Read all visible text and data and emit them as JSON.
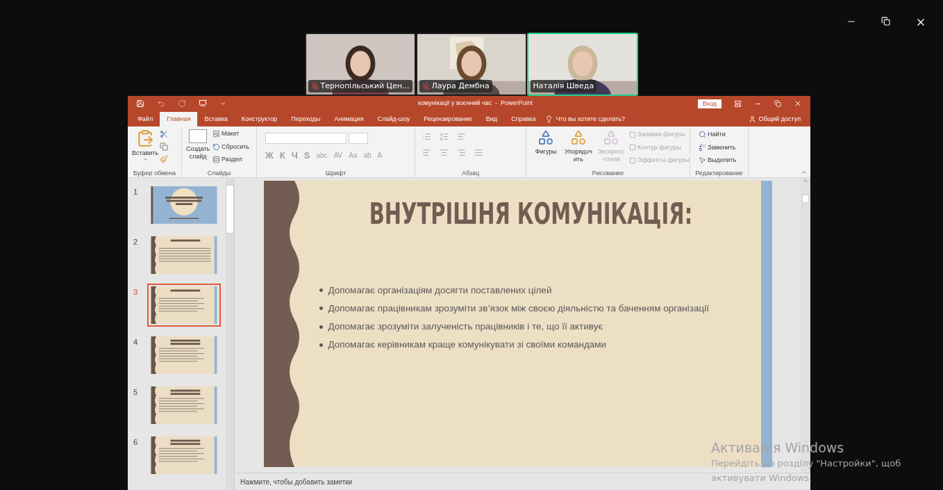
{
  "participants": [
    {
      "name": "Тернопільський Цен...",
      "muted": true,
      "speaking": false
    },
    {
      "name": "Лаура Дембна",
      "muted": true,
      "speaking": false
    },
    {
      "name": "Наталія Шведа",
      "muted": false,
      "speaking": true
    }
  ],
  "powerpoint": {
    "title": "комунікації у воєнний час  -  PowerPoint",
    "sign_in": "Вход",
    "tabs": [
      {
        "label": "Файл",
        "selected": false
      },
      {
        "label": "Главная",
        "selected": true
      },
      {
        "label": "Вставка",
        "selected": false
      },
      {
        "label": "Конструктор",
        "selected": false
      },
      {
        "label": "Переходы",
        "selected": false
      },
      {
        "label": "Анимация",
        "selected": false
      },
      {
        "label": "Слайд-шоу",
        "selected": false
      },
      {
        "label": "Рецензирование",
        "selected": false
      },
      {
        "label": "Вид",
        "selected": false
      },
      {
        "label": "Справка",
        "selected": false
      }
    ],
    "tell_me": "Что вы хотите сделать?",
    "share": "Общий доступ",
    "ribbon": {
      "clipboard": {
        "label": "Буфер обмена",
        "paste": "Вставить"
      },
      "slides": {
        "label": "Слайды",
        "new_slide": "Создать слайд",
        "items": [
          "Макет",
          "Сбросить",
          "Раздел"
        ]
      },
      "font": {
        "label": "Шрифт",
        "buttons": [
          "Ж",
          "К",
          "Ч",
          "S",
          "abc",
          "AV",
          "Aa",
          "ab",
          "A"
        ]
      },
      "paragraph": {
        "label": "Абзац"
      },
      "drawing": {
        "label": "Рисование",
        "big": [
          {
            "label": "Фигуры",
            "disabled": false
          },
          {
            "label": "Упорядочить",
            "disabled": false
          },
          {
            "label": "Экспресс-стили",
            "disabled": true
          }
        ],
        "items": [
          {
            "label": "Заливка фигуры",
            "disabled": true
          },
          {
            "label": "Контур фигуры",
            "disabled": true
          },
          {
            "label": "Эффекты фигуры",
            "disabled": true
          }
        ]
      },
      "editing": {
        "label": "Редактирование",
        "items": [
          "Найти",
          "Заменить",
          "Выделить"
        ]
      }
    },
    "thumbnails": [
      {
        "number": "1",
        "kind": "title",
        "selected": false
      },
      {
        "number": "2",
        "kind": "content",
        "selected": false
      },
      {
        "number": "3",
        "kind": "content",
        "selected": true
      },
      {
        "number": "4",
        "kind": "content",
        "selected": false
      },
      {
        "number": "5",
        "kind": "content",
        "selected": false
      },
      {
        "number": "6",
        "kind": "content",
        "selected": false
      }
    ],
    "slide": {
      "title": "ВНУТРІШНЯ КОМУНІКАЦІЯ:",
      "bullets": [
        "Допомагає організаціям досягти поставлених цілей",
        "Допомагає працівникам зрозуміти зв’язок між своєю діяльністю та баченням організації",
        "Допомагає зрозуміти залученість працівників і те, що її активує",
        "Допомагає керівникам краще комунікувати зі своїми командами"
      ]
    },
    "notes_placeholder": "Нажмите, чтобы добавить заметки"
  },
  "activation_notice": {
    "title": "Активація Windows",
    "text": "Перейдіть до розділу \"Настройки\", щоб активувати Windows."
  }
}
